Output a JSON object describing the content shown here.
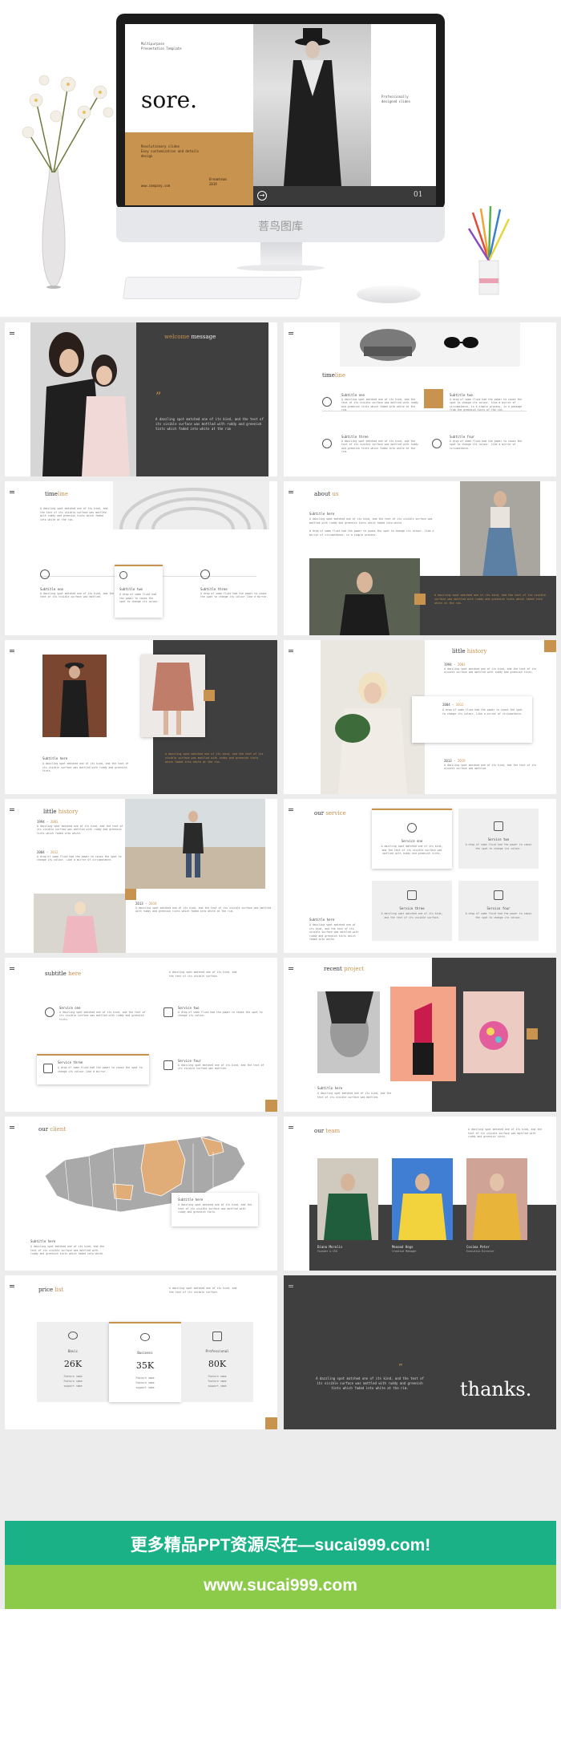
{
  "hero": {
    "sub1": "Multipurpose",
    "sub2": "Presentation Template",
    "title": "sore.",
    "gold_text_1": "Revolutionary slides",
    "gold_text_2": "Easy customization and details",
    "gold_text_3": "design",
    "gold_footer_left": "www.company.com",
    "gold_footer_right_1": "Dreamteam",
    "gold_footer_right_2": "2019",
    "right_text_1": "Professionally",
    "right_text_2": "designed slides",
    "slide_number": "01",
    "watermark": "菩鸟图库"
  },
  "slides": {
    "welcome": {
      "title_a": "welcome",
      "title_b": "message",
      "quote_mark": "”",
      "body": "A dazzling spot matched one of its kind, and the text of its visible surface was mottled with ruddy and greenish tints which faded into white at the rim"
    },
    "timeline1": {
      "title_a": "time",
      "title_b": "line",
      "items": [
        {
          "label": "Subtitle one",
          "text": "A dazzling spot matched one of its kind, and the text of its visible surface was mottled with ruddy and greenish tints which faded into white at the rim."
        },
        {
          "label": "Subtitle two",
          "text": "A drop of some fluid had the power to cause the spot to change its colour. Like a mirror of circumstance, in a simple process, is a passage from the greenish tints of the rim."
        },
        {
          "label": "Subtitle three",
          "text": "A dazzling spot matched one of its kind, and the text of its visible surface was mottled with ruddy and greenish tints which faded into white at the rim."
        },
        {
          "label": "Subtitle four",
          "text": "A drop of some fluid had the power to cause the spot to change its colour. Like a mirror of circumstance."
        }
      ]
    },
    "timeline2": {
      "title_a": "time",
      "title_b": "line",
      "intro": "A dazzling spot matched one of its kind, and the text of its visible surface was mottled with ruddy and greenish tints which faded into white at the rim.",
      "items": [
        {
          "label": "Subtitle one",
          "text": "A dazzling spot matched one of its kind, and the text of its visible surface was mottled."
        },
        {
          "label": "Subtitle two",
          "text": "A drop of some fluid had the power to cause the spot to change its colour."
        },
        {
          "label": "Subtitle three",
          "text": "A drop of some fluid had the power to cause the spot to change its colour like a mirror."
        }
      ]
    },
    "about": {
      "title_a": "about",
      "title_b": "us",
      "sub": "Subtitle here",
      "text1": "A dazzling spot matched one of its kind, and the text of its visible surface was mottled with ruddy and greenish tints which faded into white.",
      "text2": "A drop of some fluid had the power to cause the spot to change its colour. Like a mirror of circumstance, in a simple process.",
      "dark_text": "A dazzling spot matched one of its kind, and the text of its visible surface was mottled with ruddy and greenish tints which faded into white at the rim."
    },
    "gallery": {
      "sub": "Subtitle here",
      "text": "A dazzling spot matched one of its kind, and the text of its visible surface was mottled with ruddy and greenish tints.",
      "dark_text": "A dazzling spot matched one of its kind, and the text of its visible surface was mottled with ruddy and greenish tints which faded into white at the rim."
    },
    "history1": {
      "title_a": "little",
      "title_b": "history",
      "items": [
        {
          "year": "1994",
          "year_b": "2003",
          "text": "A dazzling spot matched one of its kind, and the text of its visible surface was mottled with ruddy and greenish tints."
        },
        {
          "year": "2004",
          "year_b": "2012",
          "text": "A drop of some fluid had the power to cause the spot to change its colour. Like a mirror of circumstance."
        },
        {
          "year": "2013",
          "year_b": "2019",
          "text": "A dazzling spot matched one of its kind, and the text of its visible surface was mottled."
        }
      ]
    },
    "history2": {
      "title_a": "little",
      "title_b": "history",
      "items": [
        {
          "year": "1994",
          "year_b": "2003",
          "text": "A dazzling spot matched one of its kind, and the text of its visible surface was mottled with ruddy and greenish tints which faded into white."
        },
        {
          "year": "2004",
          "year_b": "2012",
          "text": "A drop of some fluid had the power to cause the spot to change its colour. Like a mirror of circumstance."
        },
        {
          "year": "2013",
          "year_b": "2019",
          "text": "A dazzling spot matched one of its kind, and the text of its visible surface was mottled with ruddy and greenish tints which faded into white at the rim."
        }
      ]
    },
    "service": {
      "title_a": "our",
      "title_b": "service",
      "sub": "Subtitle here",
      "text": "A dazzling spot matched one of its kind, and the text of its visible surface was mottled with ruddy and greenish tints which faded into white.",
      "items": [
        {
          "label": "Service one",
          "text": "A dazzling spot matched one of its kind, and the text of its visible surface was mottled with ruddy and greenish tints."
        },
        {
          "label": "Service two",
          "text": "A drop of some fluid had the power to cause the spot to change its colour."
        },
        {
          "label": "Service three",
          "text": "A dazzling spot matched one of its kind, and the text of its visible surface."
        },
        {
          "label": "Service four",
          "text": "A drop of some fluid had the power to cause the spot to change its colour."
        }
      ]
    },
    "subtitle": {
      "title_a": "subtitle",
      "title_b": "here",
      "intro": "A dazzling spot matched one of its kind, and the text of its visible surface.",
      "items": [
        {
          "label": "Service one",
          "text": "A dazzling spot matched one of its kind, and the text of its visible surface was mottled with ruddy and greenish tints."
        },
        {
          "label": "Service two",
          "text": "A drop of some fluid had the power to cause the spot to change its colour."
        },
        {
          "label": "Service three",
          "text": "A drop of some fluid had the power to cause the spot to change its colour like a mirror."
        },
        {
          "label": "Service four",
          "text": "A dazzling spot matched one of its kind, and the text of its visible surface was mottled."
        }
      ]
    },
    "project": {
      "title_a": "recent",
      "title_b": "project",
      "sub": "Subtitle here",
      "text": "A dazzling spot matched one of its kind, and the text of its visible surface was mottled."
    },
    "client": {
      "title_a": "our",
      "title_b": "client",
      "sub": "Subtitle here",
      "text": "A dazzling spot matched one of its kind, and the text of its visible surface was mottled with ruddy and greenish tints which faded into white.",
      "card_sub": "Subtitle here",
      "card_text": "A dazzling spot matched one of its kind, and the text of its visible surface was mottled with ruddy and greenish tints."
    },
    "team": {
      "title_a": "our",
      "title_b": "team",
      "intro": "A dazzling spot matched one of its kind, and the text of its visible surface was mottled with ruddy and greenish tints.",
      "members": [
        {
          "name": "Diana Moralis",
          "role": "Founder & CEO"
        },
        {
          "name": "Meaand Hogs",
          "role": "Creative Manager"
        },
        {
          "name": "Cosima Peter",
          "role": "Executive Director"
        }
      ]
    },
    "price": {
      "title_a": "price",
      "title_b": "list",
      "intro": "A dazzling spot matched one of its kind, and the text of its visible surface.",
      "plans": [
        {
          "name": "Basic",
          "price": "26K",
          "f1": "Feature name",
          "f2": "Feature name",
          "f3": "support name"
        },
        {
          "name": "Business",
          "price": "35K",
          "f1": "Feature name",
          "f2": "Feature name",
          "f3": "support name"
        },
        {
          "name": "Professional",
          "price": "80K",
          "f1": "Feature name",
          "f2": "Feature name",
          "f3": "support name"
        }
      ]
    },
    "thanks": {
      "quote_mark": "”",
      "body": "A dazzling spot matched one of its kind, and the text of its visible surface was mottled with ruddy and greenish tints which faded into white at the rim.",
      "title": "thanks."
    }
  },
  "banner": {
    "line1": "更多精品PPT资源尽在—sucai999.com!",
    "line2": "www.sucai999.com",
    "color1": "#1ab187",
    "color2": "#8ccb4a"
  },
  "colors": {
    "accent": "#c8924f",
    "dark": "#3f3f3f"
  }
}
